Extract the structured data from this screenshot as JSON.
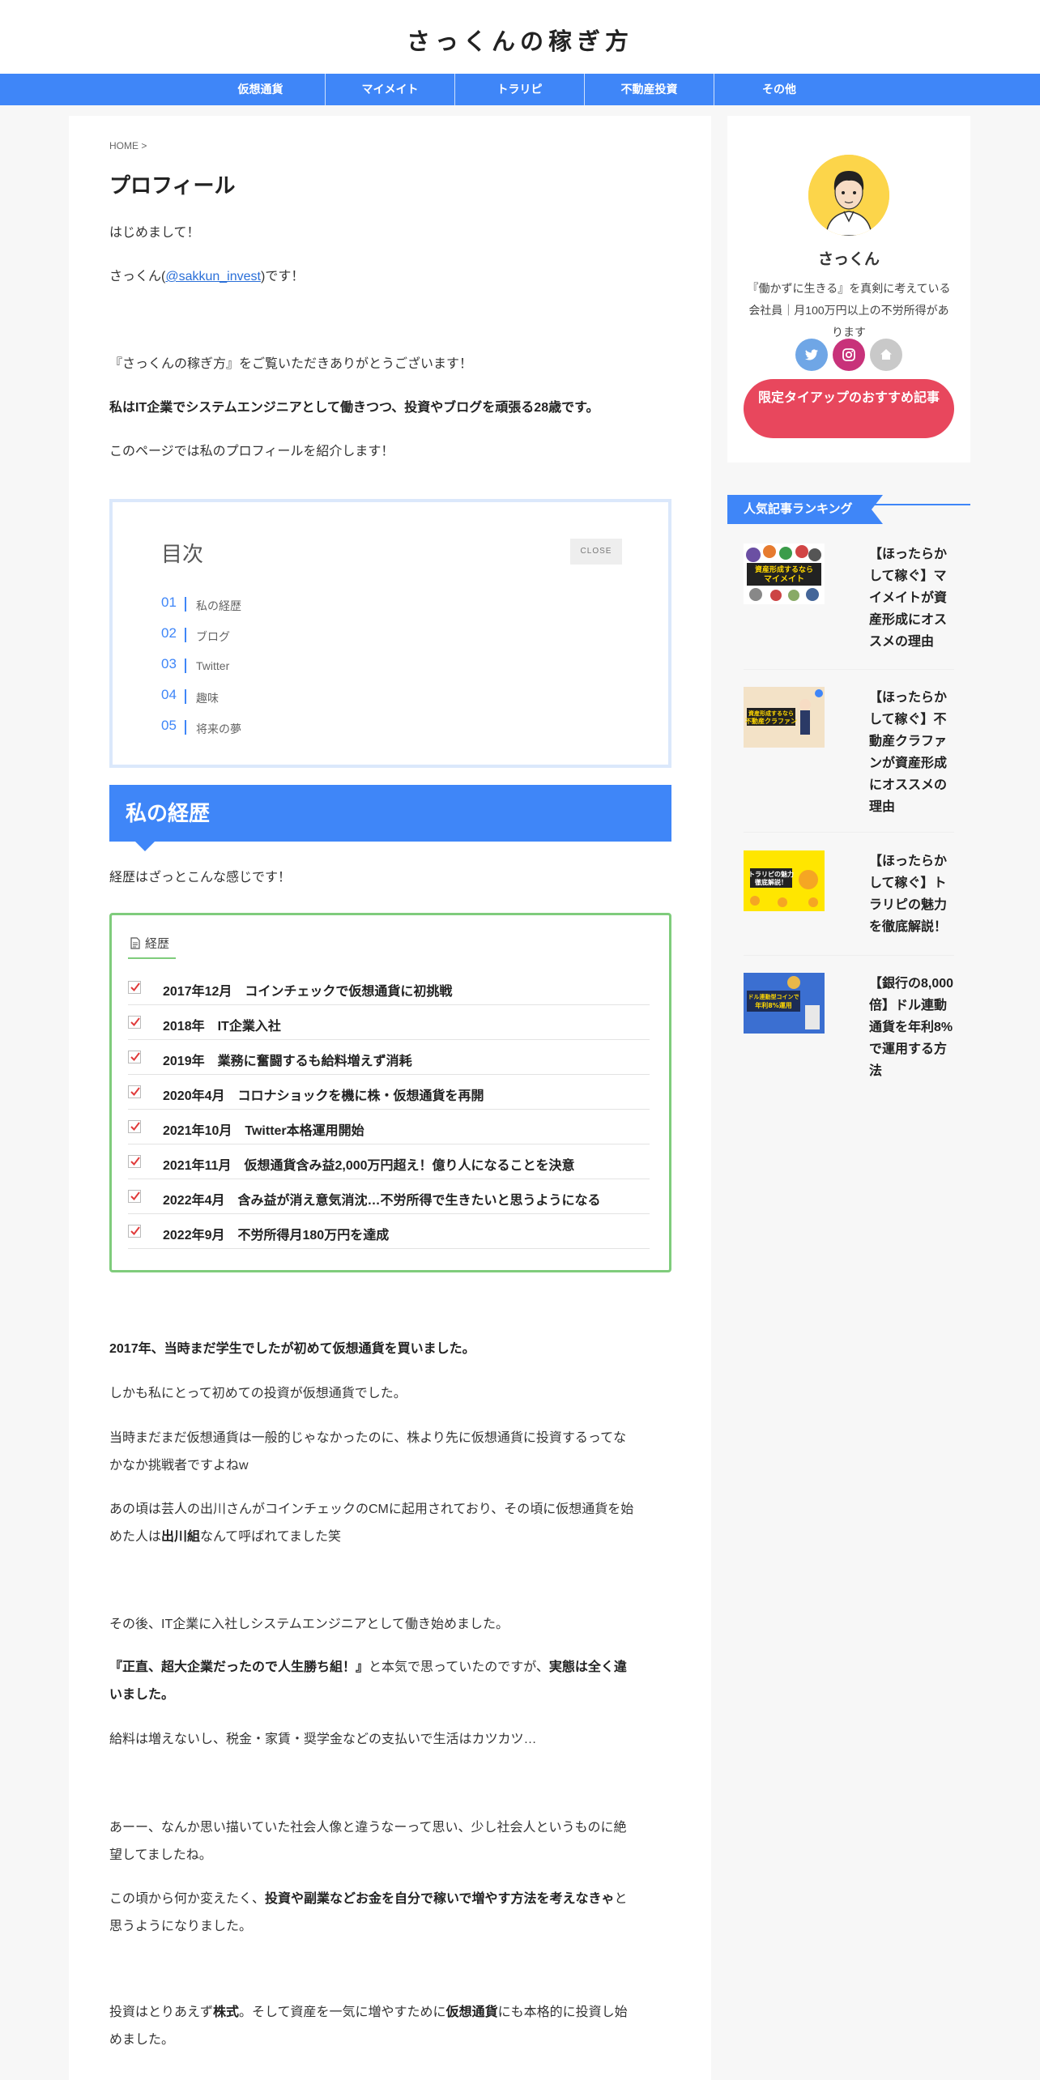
{
  "site": {
    "title": "さっくんの稼ぎ方"
  },
  "nav": [
    "仮想通貨",
    "マイメイト",
    "トラリピ",
    "不動産投資",
    "その他"
  ],
  "breadcrumb": "HOME >",
  "page_title": "プロフィール",
  "intro": {
    "greeting": "はじめまして！",
    "name_prefix": "さっくん(",
    "handle": "@sakkun_invest",
    "name_suffix": ")です！",
    "thanks": "『さっくんの稼ぎ方』をご覧いただきありがとうございます！",
    "bio": "私はIT企業でシステムエンジニアとして働きつつ、投資やブログを頑張る28歳です。",
    "page_intro": "このページでは私のプロフィールを紹介します！"
  },
  "toc": {
    "title": "目次",
    "close_label": "CLOSE",
    "items": [
      {
        "num": "01",
        "label": "私の経歴"
      },
      {
        "num": "02",
        "label": "ブログ"
      },
      {
        "num": "03",
        "label": "Twitter"
      },
      {
        "num": "04",
        "label": "趣味"
      },
      {
        "num": "05",
        "label": "将来の夢"
      }
    ]
  },
  "section1": {
    "heading": "私の経歴",
    "lead": "経歴はざっとこんな感じです！",
    "box_title": "経歴",
    "career": [
      "2017年12月　コインチェックで仮想通貨に初挑戦",
      "2018年　IT企業入社",
      "2019年　業務に奮闘するも給料増えず消耗",
      "2020年4月　コロナショックを機に株・仮想通貨を再開",
      "2021年10月　Twitter本格運用開始",
      "2021年11月　仮想通貨含み益2,000万円超え！億り人になることを決意",
      "2022年4月　含み益が消え意気消沈…不労所得で生きたいと思うようになる",
      "2022年9月　不労所得月180万円を達成"
    ]
  },
  "body": {
    "p1": "2017年、当時まだ学生でしたが初めて仮想通貨を買いました。",
    "p2": "しかも私にとって初めての投資が仮想通貨でした。",
    "p3_line1": "当時まだまだ仮想通貨は一般的じゃなかったのに、株より先に仮想通貨に投資するってな",
    "p3_line2": "かなか挑戦者ですよねw",
    "p4_line1": "あの頃は芸人の出川さんがコインチェックのCMに起用されており、その頃に仮想通貨を始",
    "p4_line2_a": "めた人は",
    "p4_line2_bold": "出川組",
    "p4_line2_b": "なんて呼ばれてました笑",
    "p5": "その後、IT企業に入社しシステムエンジニアとして働き始めました。",
    "p6_bold1": "『正直、超大企業だったので人生勝ち組！』",
    "p6_mid": "と本気で思っていたのですが、",
    "p6_bold2": "実態は全く違",
    "p6_line2_bold": "いました。",
    "p7": "給料は増えないし、税金・家賃・奨学金などの支払いで生活はカツカツ…",
    "p8_line1": "あーー、なんか思い描いていた社会人像と違うなーって思い、少し社会人というものに絶",
    "p8_line2": "望してましたね。",
    "p9_a": "この頃から何か変えたく、",
    "p9_bold": "投資や副業などお金を自分で稼いで増やす方法を考えなきゃ",
    "p9_b": "と",
    "p9_line2": "思うようになりました。",
    "p10_a": "投資はとりあえず",
    "p10_bold1": "株式",
    "p10_b": "。そして資産を一気に増やすために",
    "p10_bold2": "仮想通貨",
    "p10_c": "にも本格的に投資し始",
    "p10_line2": "めました。"
  },
  "sidebar": {
    "name": "さっくん",
    "desc": "『働かずに生きる』を真剣に考えている会社員｜月100万円以上の不労所得があります",
    "cta": "限定タイアップのおすすめ記事",
    "ranking_title": "人気記事ランキング",
    "ranking": [
      {
        "title": "【ほったらかして稼ぐ】マイメイトが資産形成にオススメの理由",
        "thumb_text": "資産形成するなら\nマイメイト"
      },
      {
        "title": "【ほったらかして稼ぐ】不動産クラファンが資産形成にオススメの理由",
        "thumb_text": "資産形成するなら\n不動産クラファン"
      },
      {
        "title": "【ほったらかして稼ぐ】トラリピの魅力を徹底解説！",
        "thumb_text": "トラリピの魅力\n徹底解説！"
      },
      {
        "title": "【銀行の8,000倍】ドル連動通貨を年利8%で運用する方法",
        "thumb_text": "ドル連動型コインで\n年利8%運用"
      }
    ]
  },
  "colors": {
    "accent": "#3f86f8",
    "cta": "#e8475d",
    "career_border": "#7fcc7c"
  }
}
